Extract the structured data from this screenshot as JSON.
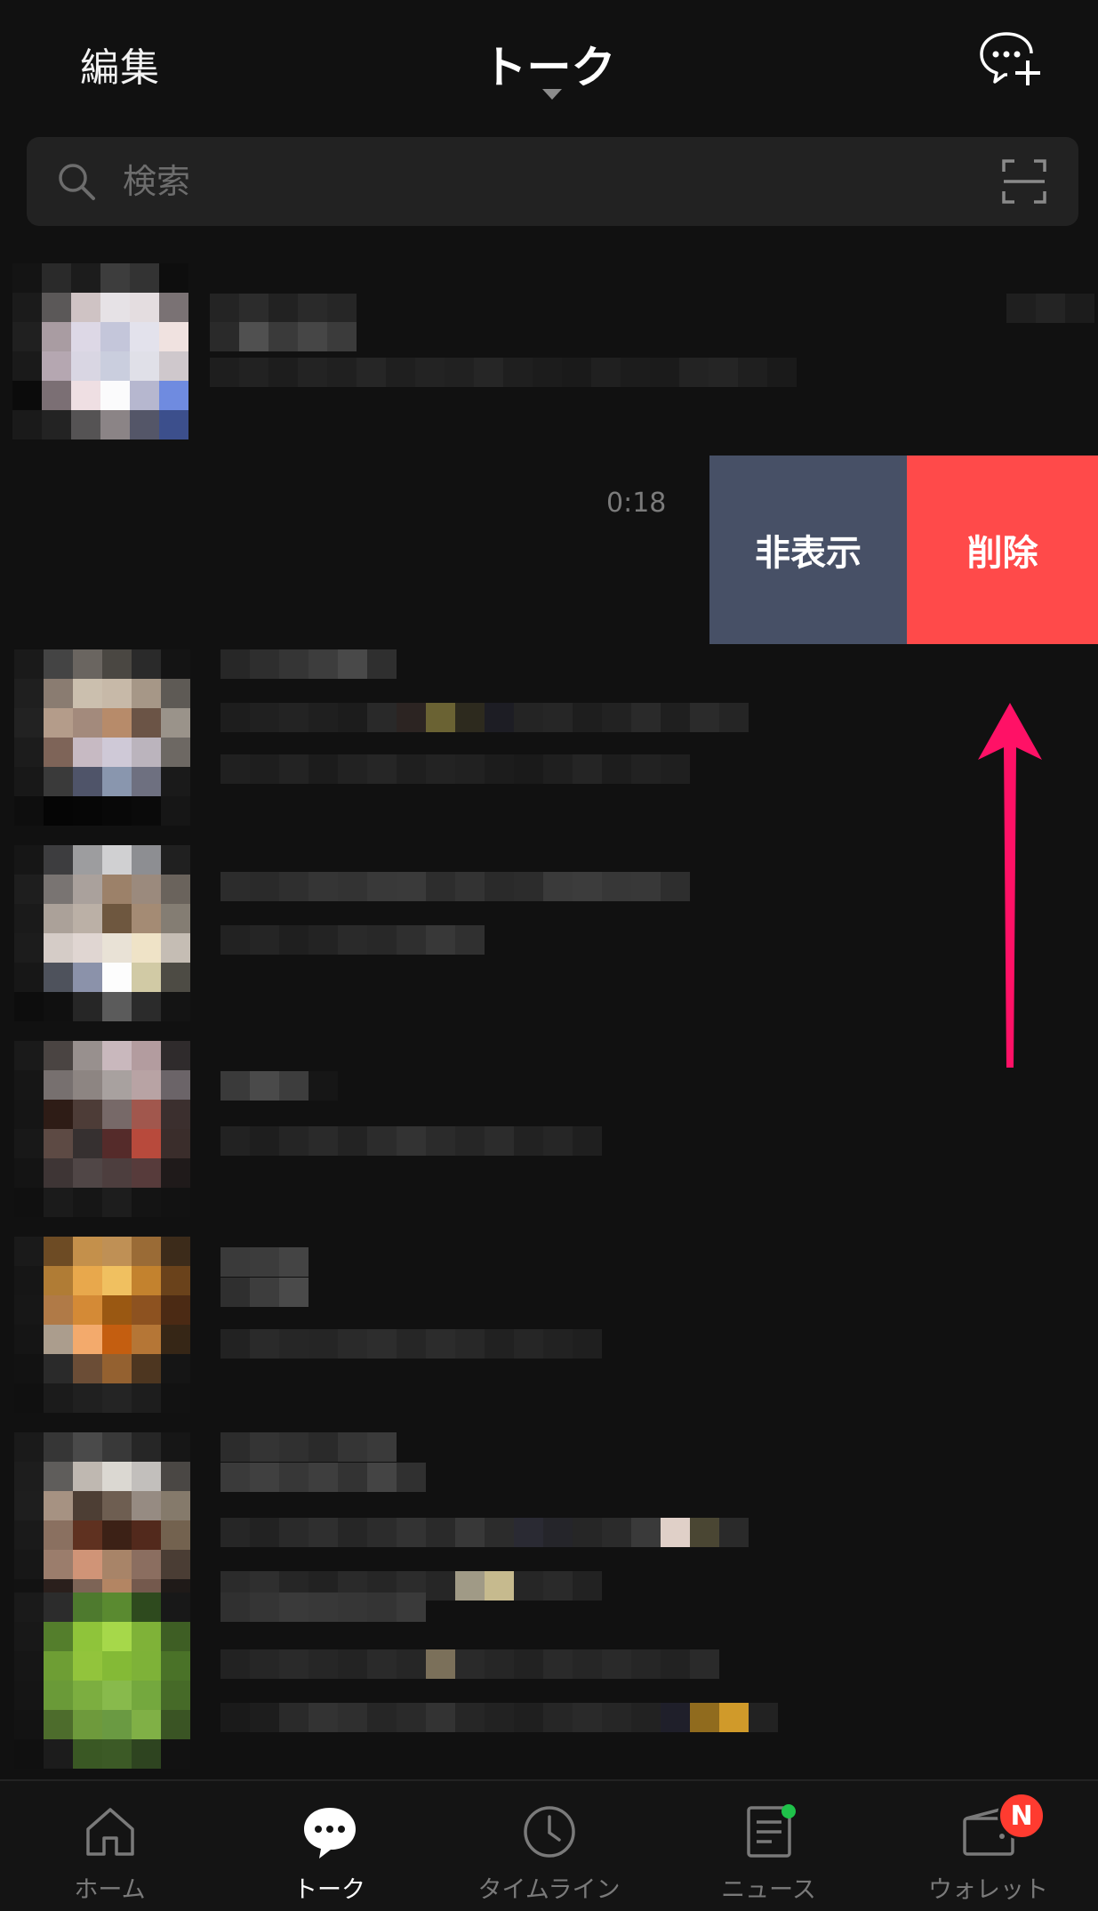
{
  "header": {
    "edit_label": "編集",
    "title": "トーク"
  },
  "search": {
    "placeholder": "検索"
  },
  "swiped_row": {
    "time": "0:18",
    "hide_label": "非表示",
    "delete_label": "削除"
  },
  "bottom_nav": {
    "items": [
      {
        "label": "ホーム",
        "icon": "home-icon"
      },
      {
        "label": "トーク",
        "icon": "chat-icon"
      },
      {
        "label": "タイムライン",
        "icon": "clock-icon"
      },
      {
        "label": "ニュース",
        "icon": "news-icon"
      },
      {
        "label": "ウォレット",
        "icon": "wallet-icon"
      }
    ],
    "wallet_badge": "N",
    "active_color": "#ffffff",
    "inactive_color": "#7a7a7a"
  },
  "colors": {
    "background": "#111111",
    "hide_button": "#475066",
    "delete_button": "#ff4a4a",
    "annotation_arrow": "#ff1166",
    "news_dot": "#1fc24a",
    "badge": "#ff3b30"
  }
}
